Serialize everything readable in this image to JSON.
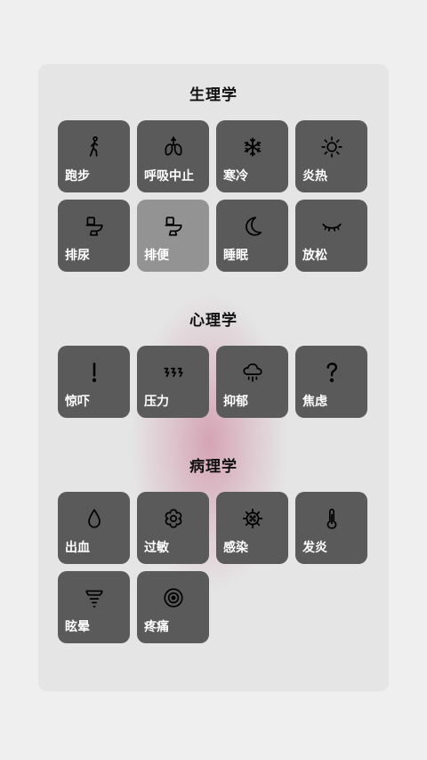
{
  "sections": [
    {
      "title": "生理学",
      "items": [
        {
          "label": "跑步",
          "icon": "running-icon"
        },
        {
          "label": "呼吸中止",
          "icon": "lungs-icon"
        },
        {
          "label": "寒冷",
          "icon": "snowflake-icon"
        },
        {
          "label": "炎热",
          "icon": "sun-icon"
        },
        {
          "label": "排尿",
          "icon": "toilet-icon"
        },
        {
          "label": "排便",
          "icon": "toilet-icon"
        },
        {
          "label": "睡眠",
          "icon": "moon-icon"
        },
        {
          "label": "放松",
          "icon": "closed-eye-icon"
        }
      ]
    },
    {
      "title": "心理学",
      "items": [
        {
          "label": "惊吓",
          "icon": "exclamation-icon"
        },
        {
          "label": "压力",
          "icon": "lightning-icon"
        },
        {
          "label": "抑郁",
          "icon": "rain-cloud-icon"
        },
        {
          "label": "焦虑",
          "icon": "question-icon"
        }
      ]
    },
    {
      "title": "病理学",
      "items": [
        {
          "label": "出血",
          "icon": "drop-icon"
        },
        {
          "label": "过敏",
          "icon": "flower-icon"
        },
        {
          "label": "感染",
          "icon": "virus-icon"
        },
        {
          "label": "发炎",
          "icon": "thermometer-icon"
        },
        {
          "label": "眩晕",
          "icon": "tornado-icon"
        },
        {
          "label": "疼痛",
          "icon": "target-icon"
        }
      ]
    }
  ],
  "selected": "排便",
  "colors": {
    "tile": "#5a5a5a",
    "tile_selected": "#939393",
    "panel": "#e5e5e5",
    "background": "#efefef",
    "glow": "#c86e8c"
  }
}
